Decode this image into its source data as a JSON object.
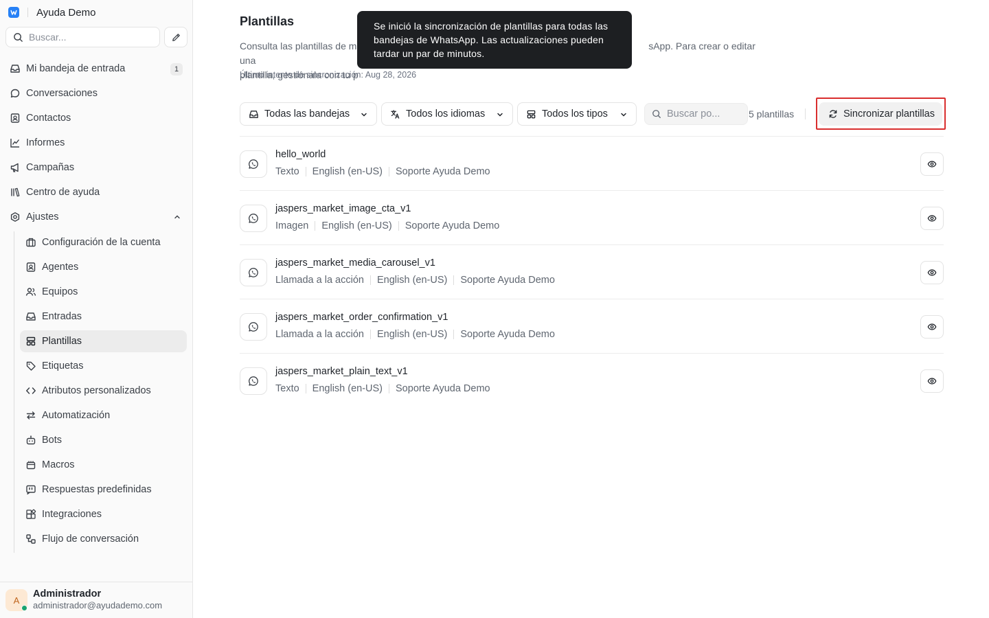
{
  "app": {
    "brand_name": "Ayuda Demo"
  },
  "sidebar": {
    "search_placeholder": "Buscar...",
    "nav": [
      {
        "label": "Mi bandeja de entrada",
        "icon": "inbox-icon",
        "badge": "1"
      },
      {
        "label": "Conversaciones",
        "icon": "chat-bubble-icon"
      },
      {
        "label": "Contactos",
        "icon": "contact-card-icon"
      },
      {
        "label": "Informes",
        "icon": "line-chart-icon"
      },
      {
        "label": "Campañas",
        "icon": "megaphone-icon"
      },
      {
        "label": "Centro de ayuda",
        "icon": "library-icon"
      },
      {
        "label": "Ajustes",
        "icon": "settings-gear-icon",
        "expanded": true
      }
    ],
    "settings_items": [
      {
        "label": "Configuración de la cuenta",
        "icon": "briefcase-icon"
      },
      {
        "label": "Agentes",
        "icon": "agent-card-icon"
      },
      {
        "label": "Equipos",
        "icon": "team-icon"
      },
      {
        "label": "Entradas",
        "icon": "inbox-icon"
      },
      {
        "label": "Plantillas",
        "icon": "template-icon",
        "active": true
      },
      {
        "label": "Etiquetas",
        "icon": "tag-icon"
      },
      {
        "label": "Atributos personalizados",
        "icon": "code-icon"
      },
      {
        "label": "Automatización",
        "icon": "automation-arrows-icon"
      },
      {
        "label": "Bots",
        "icon": "bot-icon"
      },
      {
        "label": "Macros",
        "icon": "macro-icon"
      },
      {
        "label": "Respuestas predefinidas",
        "icon": "quote-icon"
      },
      {
        "label": "Integraciones",
        "icon": "integrations-icon"
      },
      {
        "label": "Flujo de conversación",
        "icon": "flow-icon"
      }
    ],
    "user": {
      "initial": "A",
      "name": "Administrador",
      "email": "administrador@ayudademo.com",
      "status": "online"
    }
  },
  "page": {
    "title": "Plantillas",
    "description_start": "Consulta las plantillas de me",
    "description_end": "sApp. Para crear o editar una",
    "description_line2": "plantilla, gestiónala con tu p",
    "last_sync": "Último intento de sincronización: Aug 28, 2026"
  },
  "toast": {
    "message": "Se inició la sincronización de plantillas para todas las bandejas de WhatsApp. Las actualizaciones pueden tardar un par de minutos."
  },
  "filters": {
    "inbox": "Todas las bandejas",
    "language": "Todos los idiomas",
    "type": "Todos los tipos",
    "search_placeholder": "Buscar po...",
    "count": "5 plantillas",
    "sync_button": "Sincronizar plantillas"
  },
  "templates": [
    {
      "name": "hello_world",
      "type": "Texto",
      "language": "English (en-US)",
      "inbox": "Soporte Ayuda Demo"
    },
    {
      "name": "jaspers_market_image_cta_v1",
      "type": "Imagen",
      "language": "English (en-US)",
      "inbox": "Soporte Ayuda Demo"
    },
    {
      "name": "jaspers_market_media_carousel_v1",
      "type": "Llamada a la acción",
      "language": "English (en-US)",
      "inbox": "Soporte Ayuda Demo"
    },
    {
      "name": "jaspers_market_order_confirmation_v1",
      "type": "Llamada a la acción",
      "language": "English (en-US)",
      "inbox": "Soporte Ayuda Demo"
    },
    {
      "name": "jaspers_market_plain_text_v1",
      "type": "Texto",
      "language": "English (en-US)",
      "inbox": "Soporte Ayuda Demo"
    }
  ],
  "colors": {
    "brand": "#2781f6",
    "highlight": "#d92d2d",
    "online": "#1aa36f",
    "toast_bg": "#1d1f22"
  }
}
